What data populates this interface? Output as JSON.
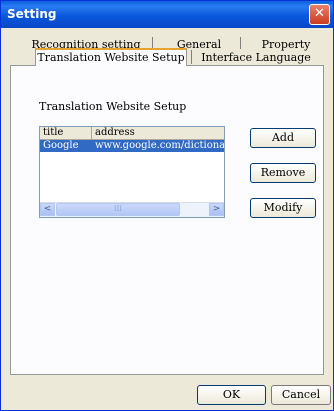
{
  "window": {
    "title": "Setting",
    "close_glyph": "✕"
  },
  "tabs": {
    "row1": [
      "Recognition setting",
      "General",
      "Property"
    ],
    "row2": [
      "Translation Website Setup",
      "Interface Language"
    ],
    "active": "Translation Website Setup"
  },
  "section": {
    "label": "Translation Website Setup"
  },
  "list": {
    "columns": [
      "title",
      "address"
    ],
    "rows": [
      {
        "title": "Google",
        "address": "www.google.com/dictionary",
        "selected": true
      }
    ],
    "scroll_left": "<",
    "scroll_right": ">",
    "thumb_grip": "III"
  },
  "buttons": {
    "add": "Add",
    "remove": "Remove",
    "modify": "Modify",
    "ok": "OK",
    "cancel": "Cancel"
  },
  "colors": {
    "titlebar": "#0a58dc",
    "selection": "#316ac5",
    "dialog_bg": "#ece9d8",
    "close_button": "#cc3b1f"
  }
}
